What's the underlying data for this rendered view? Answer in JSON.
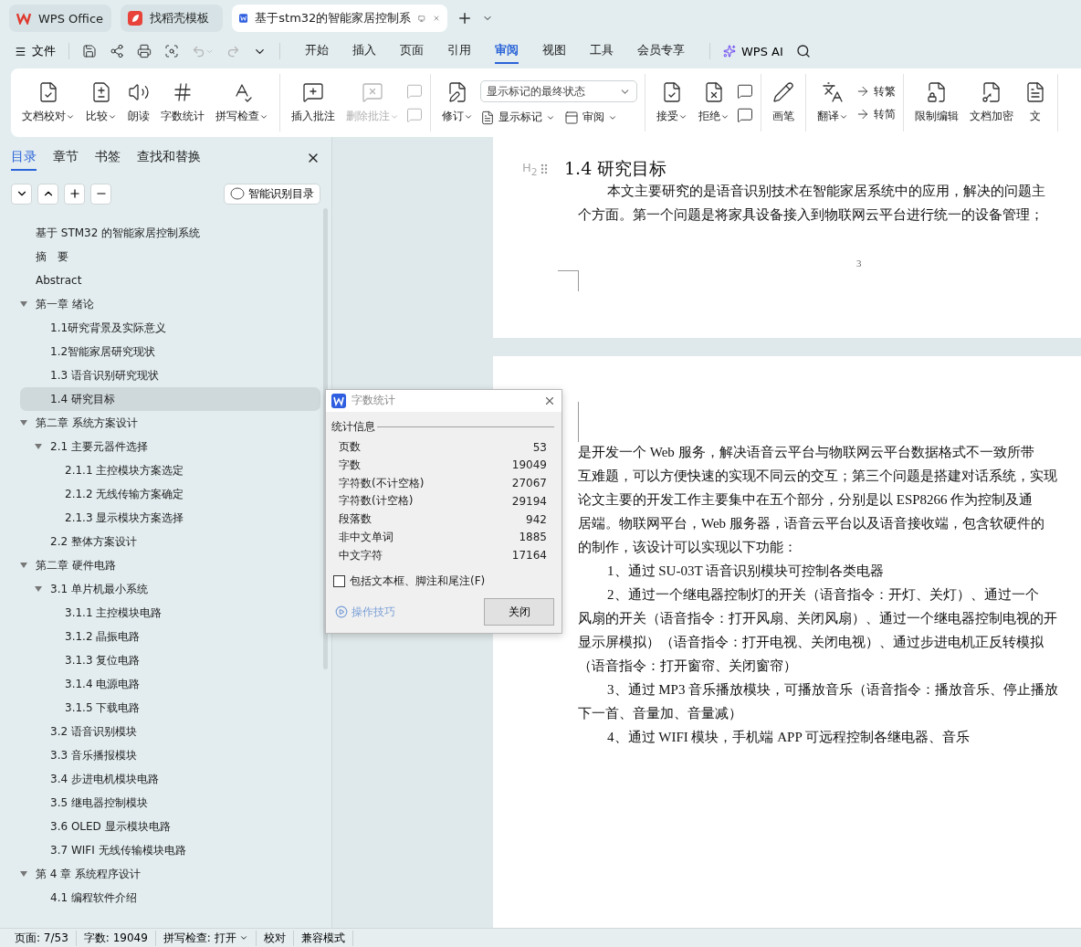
{
  "tabs": [
    {
      "label": "WPS Office",
      "kind": "home",
      "selected": false
    },
    {
      "label": "找稻壳模板",
      "kind": "template",
      "selected": false
    },
    {
      "label": "基于stm32的智能家居控制系",
      "kind": "document",
      "selected": true
    }
  ],
  "menu": {
    "file": "文件",
    "tabs": [
      {
        "label": "开始",
        "selected": false
      },
      {
        "label": "插入",
        "selected": false
      },
      {
        "label": "页面",
        "selected": false
      },
      {
        "label": "引用",
        "selected": false
      },
      {
        "label": "审阅",
        "selected": true
      },
      {
        "label": "视图",
        "selected": false
      },
      {
        "label": "工具",
        "selected": false
      },
      {
        "label": "会员专享",
        "selected": false
      }
    ],
    "ai": "WPS AI"
  },
  "ribbon": [
    {
      "columns": [
        [
          [
            {
              "kind": "large",
              "label": "文档校对",
              "dropdown": true,
              "disabled": false
            }
          ]
        ],
        [
          [
            {
              "kind": "large",
              "label": "比较",
              "dropdown": true,
              "disabled": false
            }
          ]
        ],
        [
          [
            {
              "kind": "large",
              "label": "朗读",
              "dropdown": false,
              "disabled": false
            }
          ]
        ],
        [
          [
            {
              "kind": "large",
              "label": "字数统计",
              "dropdown": false,
              "disabled": false
            }
          ]
        ],
        [
          [
            {
              "kind": "large",
              "label": "拼写检查",
              "dropdown": true,
              "disabled": false
            }
          ]
        ]
      ]
    },
    {
      "columns": [
        [
          [
            {
              "kind": "large",
              "label": "插入批注",
              "dropdown": false,
              "disabled": false
            }
          ]
        ],
        [
          [
            {
              "kind": "large",
              "label": "删除批注",
              "dropdown": true,
              "disabled": true
            }
          ]
        ],
        [
          [
            {
              "kind": "icon",
              "disabled": true
            }
          ],
          [
            {
              "kind": "icon",
              "disabled": true
            }
          ]
        ]
      ]
    },
    {
      "columns": [
        [
          [
            {
              "kind": "large",
              "label": "修订",
              "dropdown": true,
              "disabled": false
            }
          ]
        ],
        [
          [
            {
              "kind": "select",
              "value": "显示标记的最终状态"
            }
          ],
          [
            {
              "kind": "small",
              "label": "显示标记",
              "dropdown": true,
              "disabled": false
            },
            {
              "kind": "small",
              "label": "审阅",
              "dropdown": true,
              "disabled": false
            }
          ]
        ]
      ]
    },
    {
      "columns": [
        [
          [
            {
              "kind": "large",
              "label": "接受",
              "dropdown": true,
              "disabled": false
            }
          ]
        ],
        [
          [
            {
              "kind": "large",
              "label": "拒绝",
              "dropdown": true,
              "disabled": false
            }
          ]
        ],
        [
          [
            {
              "kind": "icon",
              "disabled": false
            }
          ],
          [
            {
              "kind": "icon",
              "disabled": false
            }
          ]
        ]
      ]
    },
    {
      "columns": [
        [
          [
            {
              "kind": "large",
              "label": "画笔",
              "dropdown": false,
              "disabled": false
            }
          ]
        ]
      ]
    },
    {
      "columns": [
        [
          [
            {
              "kind": "large",
              "label": "翻译",
              "dropdown": true,
              "disabled": false
            }
          ]
        ],
        [
          [
            {
              "kind": "small",
              "label": "转繁",
              "dropdown": false,
              "disabled": false
            }
          ],
          [
            {
              "kind": "small",
              "label": "转简",
              "dropdown": false,
              "disabled": false
            }
          ]
        ]
      ]
    },
    {
      "columns": [
        [
          [
            {
              "kind": "large",
              "label": "限制编辑",
              "dropdown": false,
              "disabled": false
            }
          ]
        ],
        [
          [
            {
              "kind": "large",
              "label": "文档加密",
              "dropdown": false,
              "disabled": false
            }
          ]
        ],
        [
          [
            {
              "kind": "large",
              "label": "文",
              "dropdown": false,
              "disabled": false
            }
          ]
        ]
      ]
    }
  ],
  "sidebar": {
    "tabs": [
      {
        "label": "目录",
        "selected": true
      },
      {
        "label": "章节",
        "selected": false
      },
      {
        "label": "书签",
        "selected": false
      },
      {
        "label": "查找和替换",
        "selected": false
      }
    ],
    "smart_button": "智能识别目录",
    "toc": [
      {
        "label": "基于 STM32 的智能家居控制系统",
        "selected": false
      },
      {
        "label": "摘　要",
        "selected": false
      },
      {
        "label": "Abstract",
        "selected": false
      },
      {
        "label": "第一章  绪论",
        "selected": false,
        "expanded": true,
        "children": [
          {
            "label": "1.1研究背景及实际意义",
            "selected": false
          },
          {
            "label": "1.2智能家居研究现状",
            "selected": false
          },
          {
            "label": "1.3 语音识别研究现状",
            "selected": false
          },
          {
            "label": "1.4 研究目标",
            "selected": true
          }
        ]
      },
      {
        "label": "第二章  系统方案设计",
        "selected": false,
        "expanded": true,
        "children": [
          {
            "label": "2.1  主要元器件选择",
            "selected": false,
            "expanded": true,
            "children": [
              {
                "label": "2.1.1  主控模块方案选定",
                "selected": false
              },
              {
                "label": "2.1.2  无线传输方案确定",
                "selected": false
              },
              {
                "label": "2.1.3  显示模块方案选择",
                "selected": false
              }
            ]
          },
          {
            "label": "2.2  整体方案设计",
            "selected": false
          }
        ]
      },
      {
        "label": "第二章  硬件电路",
        "selected": false,
        "expanded": true,
        "children": [
          {
            "label": "3.1 单片机最小系统",
            "selected": false,
            "expanded": true,
            "children": [
              {
                "label": "3.1.1  主控模块电路",
                "selected": false
              },
              {
                "label": "3.1.2  晶振电路",
                "selected": false
              },
              {
                "label": "3.1.3  复位电路",
                "selected": false
              },
              {
                "label": "3.1.4  电源电路",
                "selected": false
              },
              {
                "label": "3.1.5  下载电路",
                "selected": false
              }
            ]
          },
          {
            "label": "3.2 语音识别模块",
            "selected": false
          },
          {
            "label": "3.3 音乐播报模块",
            "selected": false
          },
          {
            "label": "3.4 步进电机模块电路",
            "selected": false
          },
          {
            "label": "3.5 继电器控制模块",
            "selected": false
          },
          {
            "label": "3.6 OLED 显示模块电路",
            "selected": false
          },
          {
            "label": "3.7 WIFI 无线传输模块电路",
            "selected": false
          }
        ]
      },
      {
        "label": "第 4 章  系统程序设计",
        "selected": false,
        "expanded": true,
        "children": [
          {
            "label": "4.1  编程软件介绍",
            "selected": false
          }
        ]
      }
    ]
  },
  "document": {
    "heading_marker": "H$_{2}$",
    "heading": "1.4 研究目标",
    "page_1_lines": [
      {
        "text": "本文主要研究的是语音识别技术在智能家居系统中的应用，解决的问题主",
        "indent": true
      },
      {
        "text": "个方面。第一个问题是将家具设备接入到物联网云平台进行统一的设备管理；",
        "indent": false
      }
    ],
    "page_number": "3",
    "page_2_lines": [
      {
        "text": "是开发一个 Web 服务，解决语音云平台与物联网云平台数据格式不一致所带",
        "indent": false
      },
      {
        "text": "互难题，可以方便快速的实现不同云的交互；第三个问题是搭建对话系统，实现",
        "indent": false
      },
      {
        "text": "论文主要的开发工作主要集中在五个部分，分别是以 ESP8266 作为控制及通",
        "indent": false
      },
      {
        "text": "居端。物联网平台，Web 服务器，语音云平台以及语音接收端，包含软硬件的",
        "indent": false
      },
      {
        "text": "的制作，该设计可以实现以下功能：",
        "indent": false
      },
      {
        "text": "1、通过 SU-03T 语音识别模块可控制各类电器",
        "indent": true
      },
      {
        "text": "2、通过一个继电器控制灯的开关（语音指令：开灯、关灯）、通过一个",
        "indent": true
      },
      {
        "text": "风扇的开关（语音指令：打开风扇、关闭风扇）、通过一个继电器控制电视的开",
        "indent": false
      },
      {
        "text": "显示屏模拟）（语音指令：打开电视、关闭电视）、通过步进电机正反转模拟",
        "indent": false
      },
      {
        "text": "（语音指令：打开窗帘、关闭窗帘）",
        "indent": false
      },
      {
        "text": "3、通过 MP3 音乐播放模块，可播放音乐（语音指令：播放音乐、停止播放",
        "indent": true
      },
      {
        "text": "下一首、音量加、音量减）",
        "indent": false
      },
      {
        "text": "4、通过 WIFI 模块，手机端 APP 可远程控制各继电器、音乐",
        "indent": true
      }
    ]
  },
  "dialog": {
    "title": "字数统计",
    "section": "统计信息",
    "stats": [
      {
        "label": "页数",
        "value": "53"
      },
      {
        "label": "字数",
        "value": "19049"
      },
      {
        "label": "字符数(不计空格)",
        "value": "27067"
      },
      {
        "label": "字符数(计空格)",
        "value": "29194"
      },
      {
        "label": "段落数",
        "value": "942"
      },
      {
        "label": "非中文单词",
        "value": "1885"
      },
      {
        "label": "中文字符",
        "value": "17164"
      }
    ],
    "checkbox": {
      "label": "包括文本框、脚注和尾注(F)",
      "checked": false
    },
    "tips_link": "操作技巧",
    "close_button": "关闭"
  },
  "status_bar": [
    {
      "text": "页面: 7/53",
      "dropdown": false
    },
    {
      "text": "字数: 19049",
      "dropdown": false
    },
    {
      "text": "拼写检查: 打开",
      "dropdown": true
    },
    {
      "text": "校对",
      "dropdown": false
    },
    {
      "text": "兼容模式",
      "dropdown": false
    }
  ]
}
